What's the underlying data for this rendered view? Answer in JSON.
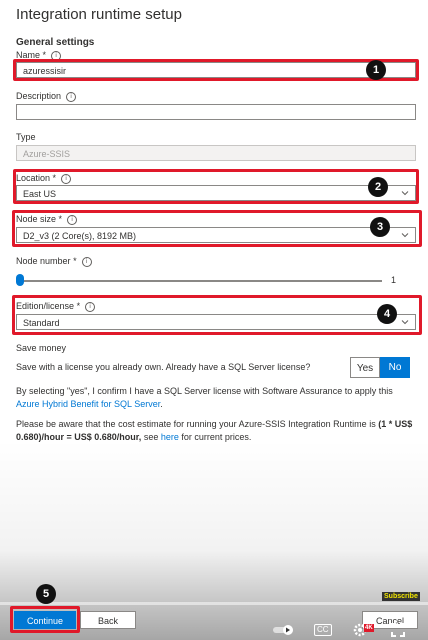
{
  "header": {
    "title": "Integration runtime setup"
  },
  "general": {
    "heading": "General settings",
    "name_label": "Name",
    "name_required": "*",
    "name_value": "azuressisir",
    "description_label": "Description",
    "description_value": "",
    "type_label": "Type",
    "type_value": "Azure-SSIS",
    "location_label": "Location",
    "location_required": "*",
    "location_value": "East US",
    "node_size_label": "Node size",
    "node_size_required": "*",
    "node_size_value": "D2_v3 (2 Core(s), 8192 MB)",
    "node_number_label": "Node number",
    "node_number_required": "*",
    "node_number_value": "1",
    "node_number_fraction": 0.0,
    "edition_label": "Edition/license",
    "edition_required": "*",
    "edition_value": "Standard"
  },
  "save_money": {
    "heading": "Save money",
    "question": "Save with a license you already own. Already have a SQL Server license?",
    "yes_label": "Yes",
    "no_label": "No",
    "confirm_text": "By selecting \"yes\", I confirm I have a SQL Server license with Software Assurance to apply this",
    "confirm_link": "Azure Hybrid Benefit for SQL Server",
    "confirm_end": ".",
    "estimate_text": "Please be aware that the cost estimate for running your Azure-SSIS Integration Runtime is",
    "estimate_bold": "(1 * US$ 0.680)/hour = US$ 0.680/hour,",
    "estimate_see": "see",
    "estimate_link": "here",
    "estimate_end": "for current prices."
  },
  "footer": {
    "continue_label": "Continue",
    "back_label": "Back",
    "cancel_label": "Cancel"
  },
  "annotations": {
    "badge1": "1",
    "badge2": "2",
    "badge3": "3",
    "badge4": "4",
    "badge5": "5"
  },
  "video": {
    "subscribe_label": "Subscribe",
    "quality_label": "4K",
    "cc_label": "CC"
  },
  "colors": {
    "accent": "#0078d4",
    "highlight": "#e0192a",
    "badge": "#111111"
  }
}
